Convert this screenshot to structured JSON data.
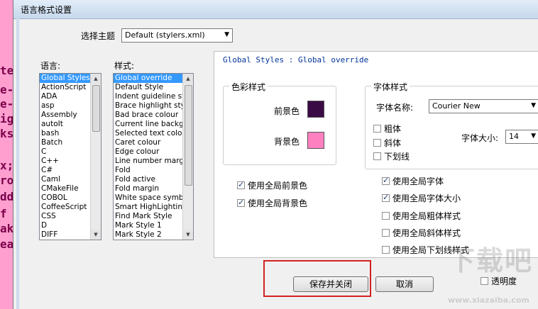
{
  "background_app": {
    "title_fragment": "格式",
    "code_lines": [
      "te",
      "e-",
      "e-",
      "ig",
      "ks",
      "x;",
      "ro",
      "dd",
      " f",
      "ak",
      "ea"
    ]
  },
  "dialog": {
    "title": "语言格式设置",
    "theme_label": "选择主题",
    "theme_value": "Default (stylers.xml)"
  },
  "languages": {
    "label": "语言:",
    "items": [
      "Global Styles",
      "ActionScript",
      "ADA",
      "asp",
      "Assembly",
      "autoIt",
      "bash",
      "Batch",
      "C",
      "C++",
      "C#",
      "Caml",
      "CMakeFile",
      "COBOL",
      "CoffeeScript",
      "CSS",
      "D",
      "DIFF"
    ],
    "selected_index": 0
  },
  "styles": {
    "label": "样式:",
    "items": [
      "Global override",
      "Default Style",
      "Indent guideline style",
      "Brace highlight style",
      "Bad brace colour",
      "Current line background",
      "Selected text colour",
      "Caret colour",
      "Edge colour",
      "Line number margin",
      "Fold",
      "Fold active",
      "Fold margin",
      "White space symbol",
      "Smart HighLighting",
      "Find Mark Style",
      "Mark Style 1",
      "Mark Style 2"
    ],
    "selected_index": 0
  },
  "panel": {
    "header": "Global Styles : Global override",
    "color_group_title": "色彩样式",
    "fg_label": "前景色",
    "bg_label": "背景色",
    "fg_color": "#3a0a45",
    "bg_color": "#ff80c0",
    "font_group_title": "字体样式",
    "font_name_label": "字体名称:",
    "font_name_value": "Courier New",
    "bold_label": "粗体",
    "italic_label": "斜体",
    "underline_label": "下划线",
    "font_size_label": "字体大小:",
    "font_size_value": "14",
    "use_global_fg": "使用全局前景色",
    "use_global_bg": "使用全局背景色",
    "use_global_font": "使用全局字体",
    "use_global_font_size": "使用全局字体大小",
    "use_global_bold": "使用全局粗体样式",
    "use_global_italic": "使用全局斜体样式",
    "use_global_underline": "使用全局下划线样式"
  },
  "buttons": {
    "save_close": "保存并关闭",
    "cancel": "取消"
  },
  "transparency_label": "透明度",
  "watermark": {
    "text": "下载吧",
    "small": "www.xiazaiba.com"
  },
  "highlight_color": "#d32020"
}
